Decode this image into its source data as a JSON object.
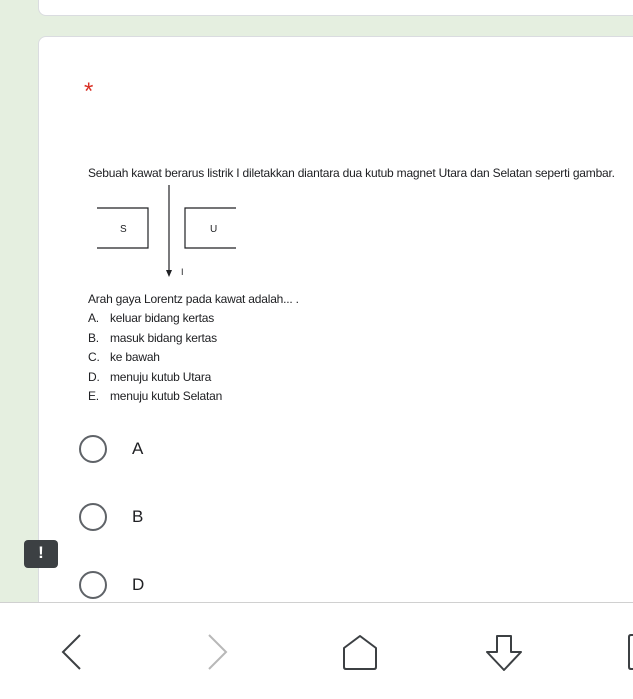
{
  "question": {
    "required_mark": "*",
    "intro": "Sebuah kawat berarus listrik I diletakkan diantara dua kutub magnet Utara dan Selatan seperti gambar.",
    "diagram": {
      "left_pole": "S",
      "right_pole": "U",
      "current_label": "I"
    },
    "prompt": "Arah gaya Lorentz pada kawat adalah... .",
    "options_text": [
      {
        "letter": "A.",
        "text": "keluar bidang kertas"
      },
      {
        "letter": "B.",
        "text": "masuk bidang kertas"
      },
      {
        "letter": "C.",
        "text": "ke bawah"
      },
      {
        "letter": "D.",
        "text": "menuju kutub Utara"
      },
      {
        "letter": "E.",
        "text": "menuju kutub Selatan"
      }
    ]
  },
  "choices": [
    {
      "label": "A"
    },
    {
      "label": "B"
    },
    {
      "label": "D"
    }
  ],
  "feedback_button": {
    "icon": "report-icon",
    "symbol": "!"
  },
  "navbar": {
    "icons": [
      "back-icon",
      "forward-icon",
      "home-icon",
      "download-icon",
      "tabs-icon"
    ]
  }
}
